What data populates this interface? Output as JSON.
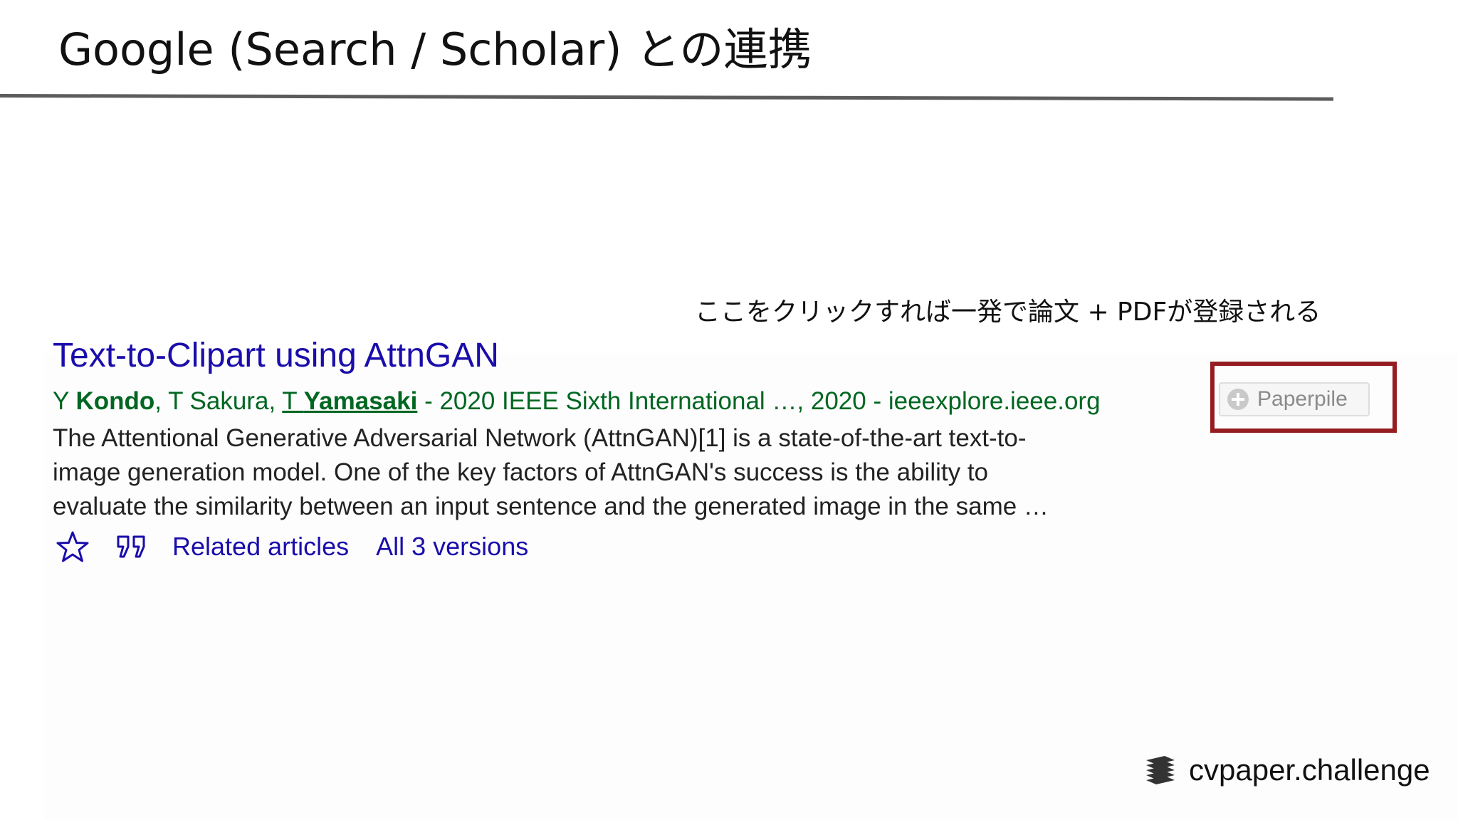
{
  "slide": {
    "title": "Google (Search / Scholar) との連携",
    "annotation": "ここをクリックすれば一発で論文 + PDFが登録される",
    "brand": "cvpaper.challenge"
  },
  "result": {
    "title": "Text-to-Clipart using AttnGAN",
    "authors": {
      "initial_1": "Y ",
      "author_1": "Kondo",
      "sep_1": ", ",
      "author_2": "T Sakura",
      "sep_2": ", ",
      "initial_3": "T ",
      "author_3": "Yamasaki"
    },
    "source": " - 2020 IEEE Sixth International …, 2020 - ieeexplore.ieee.org",
    "snippet_lines": [
      "The Attentional Generative Adversarial Network (AttnGAN)[1] is a state-of-the-art text-to-",
      "image generation model. One of the key factors of AttnGAN's success is the ability to",
      "evaluate the similarity between an input sentence and the generated image in the same …"
    ],
    "actions": {
      "related": "Related articles",
      "versions": "All 3 versions"
    },
    "paperpile_label": "Paperpile"
  },
  "colors": {
    "link": "#1a0dab",
    "meta_green": "#006621",
    "highlight_red": "#951d22"
  },
  "icons": [
    "star-icon",
    "quote-icon",
    "plus-circle-icon",
    "layers-icon"
  ]
}
